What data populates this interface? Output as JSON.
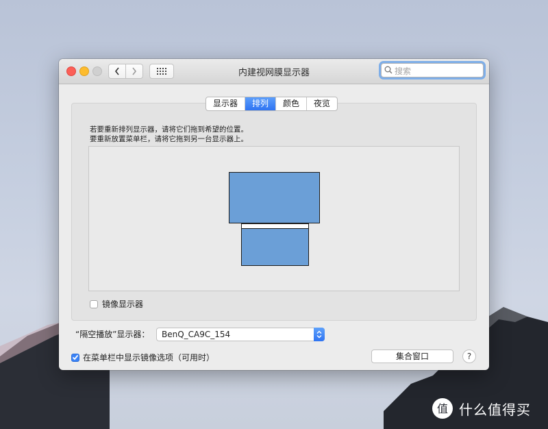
{
  "window": {
    "title": "内建视网膜显示器"
  },
  "search": {
    "placeholder": "搜索"
  },
  "tabs": [
    {
      "label": "显示器",
      "active": false
    },
    {
      "label": "排列",
      "active": true
    },
    {
      "label": "颜色",
      "active": false
    },
    {
      "label": "夜览",
      "active": false
    }
  ],
  "arrangement": {
    "instruction_1": "若要重新排列显示器，请将它们拖到希望的位置。",
    "instruction_2": "要重新放置菜单栏，请将它拖到另一台显示器上。"
  },
  "mirror": {
    "label": "镜像显示器",
    "checked": false
  },
  "airplay": {
    "label": "“隔空播放”显示器：",
    "selected": "BenQ_CA9C_154"
  },
  "menubar_option": {
    "label": "在菜单栏中显示镜像选项（可用时）",
    "checked": true
  },
  "buttons": {
    "gather": "集合窗口",
    "help": "?"
  },
  "watermark": {
    "text": "什么值得买",
    "logo_text": "值"
  },
  "colors": {
    "accent": "#3478f6",
    "display_fill": "#6b9fd7",
    "close": "#fc5f57",
    "minimize": "#fdbc2e"
  }
}
